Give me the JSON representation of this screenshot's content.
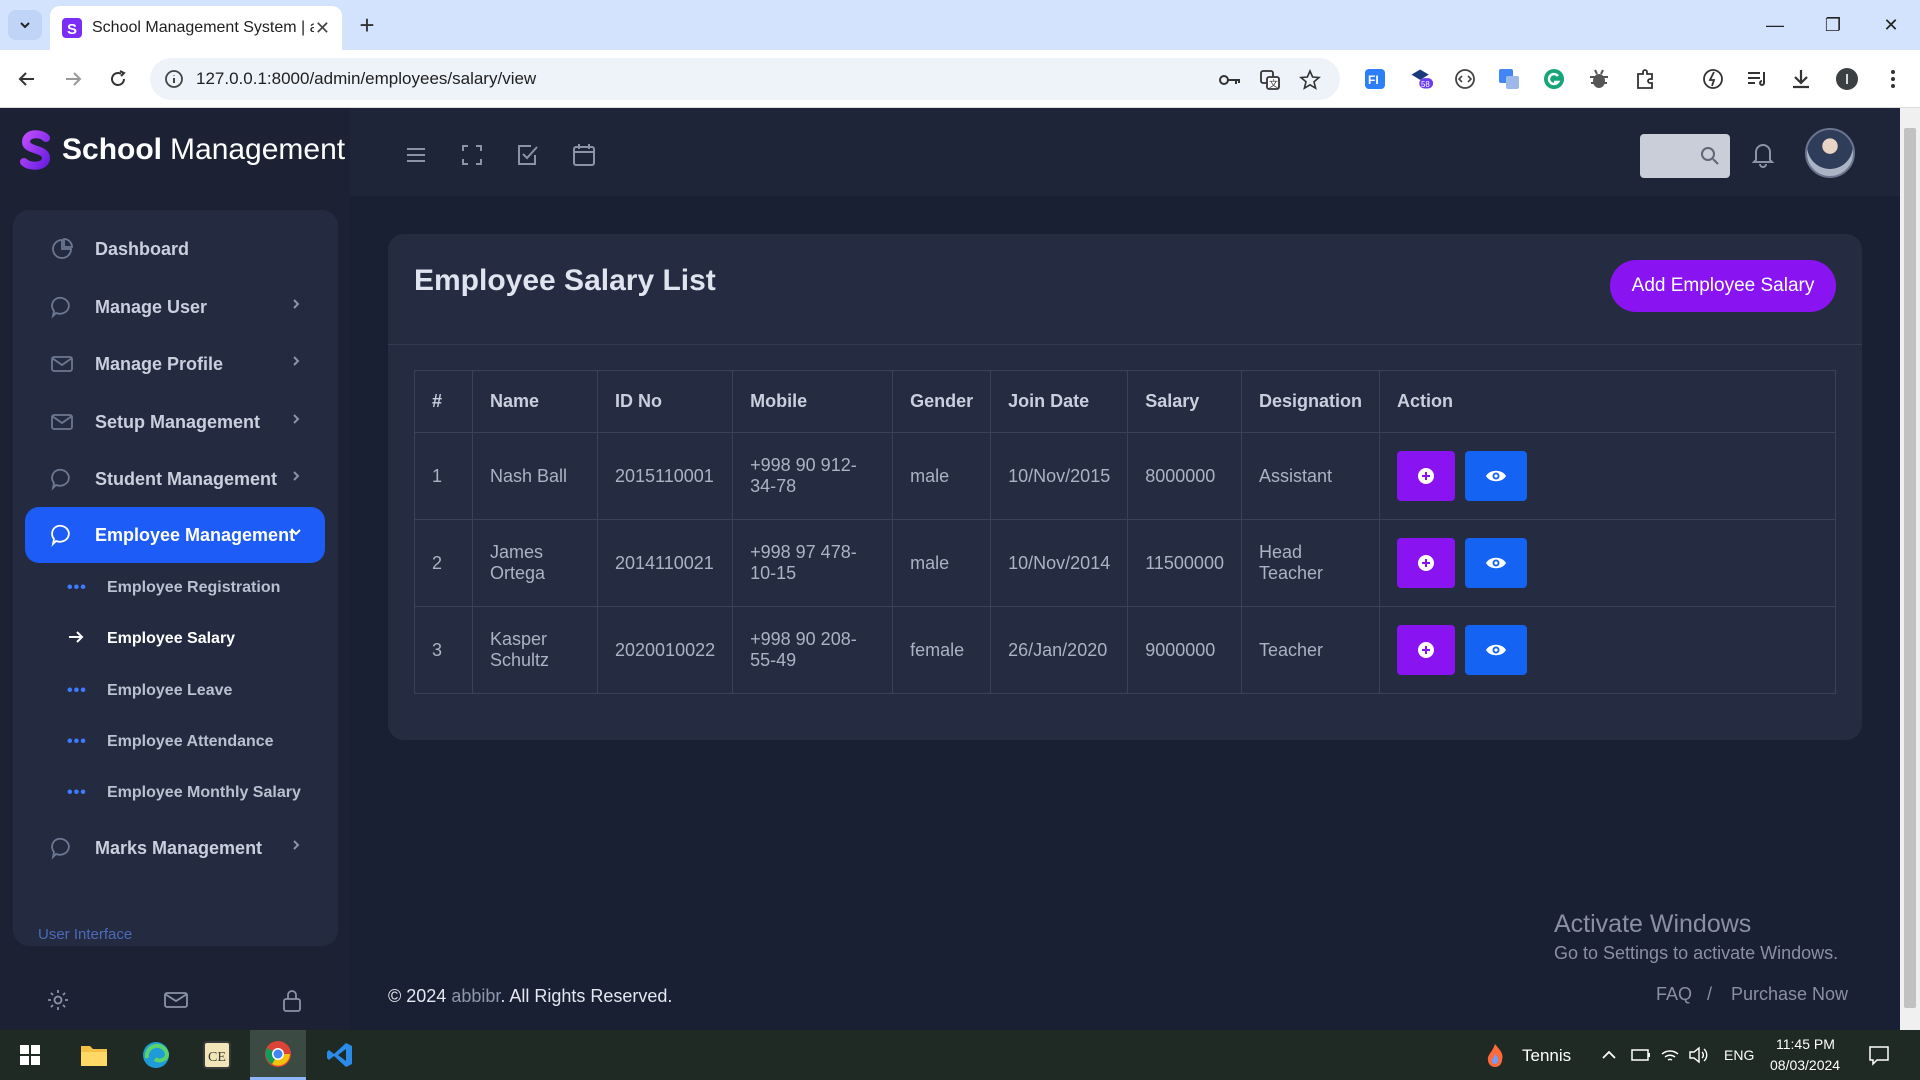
{
  "browser": {
    "tab_title": "School Management System | a",
    "url": "127.0.0.1:8000/admin/employees/salary/view",
    "extension_badge": "58"
  },
  "brand": {
    "bold": "School",
    "light": "Management"
  },
  "sidebar": {
    "items": [
      {
        "label": "Dashboard",
        "icon": "pie-chart-icon",
        "has_chevron": false
      },
      {
        "label": "Manage User",
        "icon": "chat-bubble-icon",
        "has_chevron": true
      },
      {
        "label": "Manage Profile",
        "icon": "mail-icon",
        "has_chevron": true
      },
      {
        "label": "Setup Management",
        "icon": "mail-icon",
        "has_chevron": true
      },
      {
        "label": "Student Management",
        "icon": "chat-bubble-icon",
        "has_chevron": true
      },
      {
        "label": "Employee Management",
        "icon": "chat-bubble-icon",
        "has_chevron": true,
        "active": true
      },
      {
        "label": "Marks Management",
        "icon": "chat-bubble-icon",
        "has_chevron": true
      }
    ],
    "sub_items": [
      {
        "label": "Employee Registration"
      },
      {
        "label": "Employee Salary",
        "active": true
      },
      {
        "label": "Employee Leave"
      },
      {
        "label": "Employee Attendance"
      },
      {
        "label": "Employee Monthly Salary"
      }
    ],
    "section_label": "User Interface"
  },
  "page": {
    "title": "Employee Salary List",
    "add_button": "Add Employee Salary"
  },
  "table": {
    "headers": [
      "#",
      "Name",
      "ID No",
      "Mobile",
      "Gender",
      "Join Date",
      "Salary",
      "Designation",
      "Action"
    ],
    "rows": [
      [
        "1",
        "Nash Ball",
        "2015110001",
        "+998 90 912-34-78",
        "male",
        "10/Nov/2015",
        "8000000",
        "Assistant"
      ],
      [
        "2",
        "James Ortega",
        "2014110021",
        "+998 97 478-10-15",
        "male",
        "10/Nov/2014",
        "11500000",
        "Head Teacher"
      ],
      [
        "3",
        "Kasper Schultz",
        "2020010022",
        "+998 90 208-55-49",
        "female",
        "26/Jan/2020",
        "9000000",
        "Teacher"
      ]
    ]
  },
  "footer": {
    "prefix": "© 2024 ",
    "link": "abbibr",
    "suffix": ". All Rights Reserved."
  },
  "watermark": {
    "line1": "Activate Windows",
    "line2": "Go to Settings to activate Windows.",
    "faq": "FAQ",
    "separator": "/",
    "purchase": "Purchase Now"
  },
  "taskbar": {
    "weather": "Tennis",
    "language": "ENG",
    "time": "11:45 PM",
    "date": "08/03/2024"
  },
  "colors": {
    "accent_purple": "#8a13f2",
    "accent_blue": "#1d5cf6",
    "background": "#1a2033",
    "card": "#252c42"
  }
}
